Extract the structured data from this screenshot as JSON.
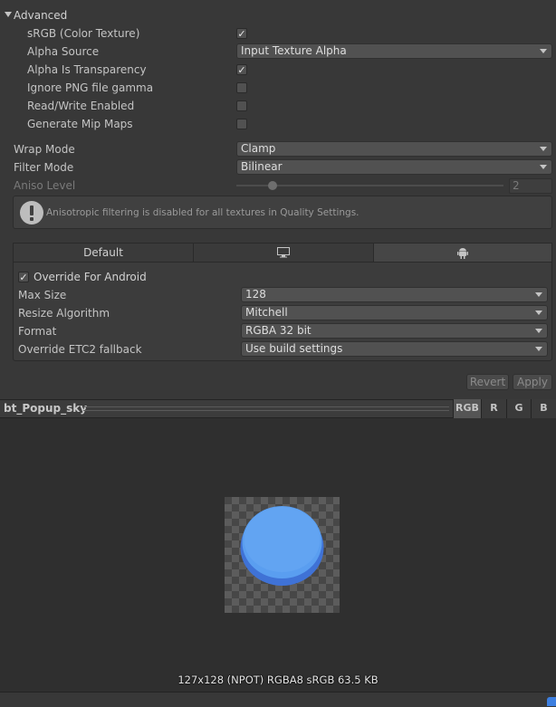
{
  "advanced": {
    "title": "Advanced",
    "srgb_label": "sRGB (Color Texture)",
    "alpha_source_label": "Alpha Source",
    "alpha_source_value": "Input Texture Alpha",
    "alpha_transparency_label": "Alpha Is Transparency",
    "ignore_png_label": "Ignore PNG file gamma",
    "read_write_label": "Read/Write Enabled",
    "mipmaps_label": "Generate Mip Maps",
    "check_mark": "✓"
  },
  "wrap_mode": {
    "label": "Wrap Mode",
    "value": "Clamp"
  },
  "filter_mode": {
    "label": "Filter Mode",
    "value": "Bilinear"
  },
  "aniso": {
    "label": "Aniso Level",
    "value": "2"
  },
  "help": {
    "text": "Anisotropic filtering is disabled for all textures in Quality Settings.",
    "icon": "info-icon"
  },
  "platform_tabs": {
    "default_label": "Default",
    "standalone_icon": "monitor-icon",
    "android_icon": "android-icon"
  },
  "android": {
    "override_label": "Override For Android",
    "max_size_label": "Max Size",
    "max_size_value": "128",
    "resize_label": "Resize Algorithm",
    "resize_value": "Mitchell",
    "format_label": "Format",
    "format_value": "RGBA 32 bit",
    "etc2_label": "Override ETC2 fallback",
    "etc2_value": "Use build settings"
  },
  "actions": {
    "revert": "Revert",
    "apply": "Apply"
  },
  "preview": {
    "name": "bt_Popup_sky",
    "channels": [
      "RGB",
      "R",
      "G",
      "B"
    ],
    "info": "127x128 (NPOT)  RGBA8 sRGB   63.5 KB"
  },
  "colors": {
    "accent": "#3d7fe0",
    "sprite_blue": "#5a9ef0"
  }
}
